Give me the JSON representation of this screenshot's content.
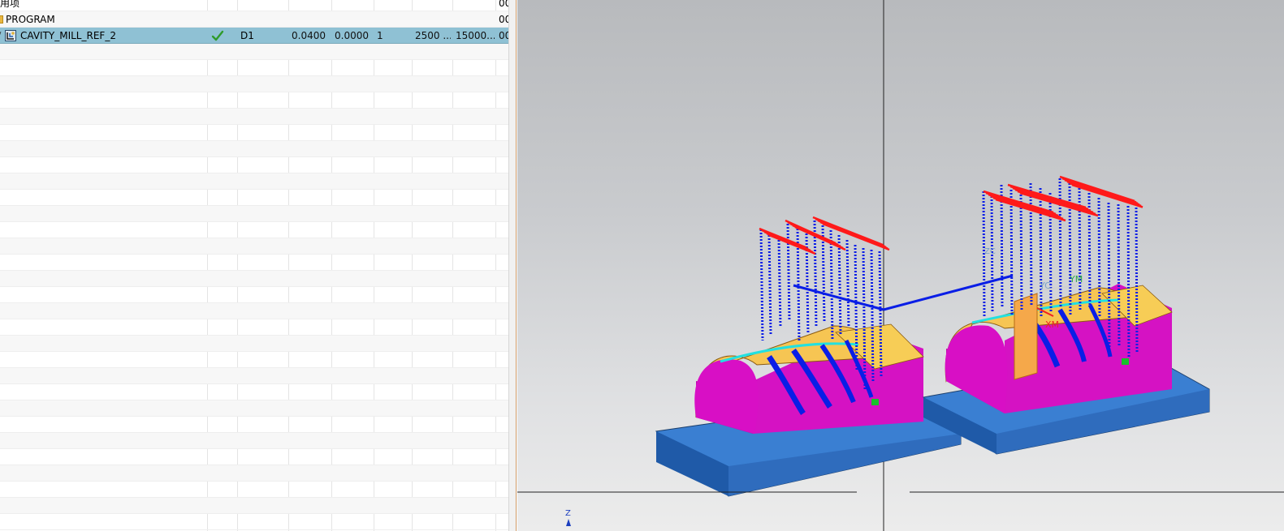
{
  "navigator": {
    "rows": [
      {
        "name": "未用项",
        "display_text": "未用项",
        "c7": "00"
      },
      {
        "name": "PROGRAM",
        "c7": "00"
      },
      {
        "name": "CAVITY_MILL_REF_2",
        "tool": "D1",
        "v1": "0.0400",
        "v2": "0.0000",
        "v3": "1",
        "speed": "2500 ...",
        "feed": "15000...",
        "c7": "00"
      }
    ],
    "cropped_first_label": "用项"
  },
  "viewport": {
    "labels": {
      "ym": "YM",
      "yc": "YC",
      "xm": "XM",
      "zc": "ZC",
      "axis_z": "Z"
    },
    "colors": {
      "toolpath": "#0a1ee6",
      "retract": "#ff1a1a",
      "part_top": "#f7c94d",
      "part_side": "#e014c8",
      "base": "#3f86d6",
      "csys": "#f5a84a"
    }
  }
}
